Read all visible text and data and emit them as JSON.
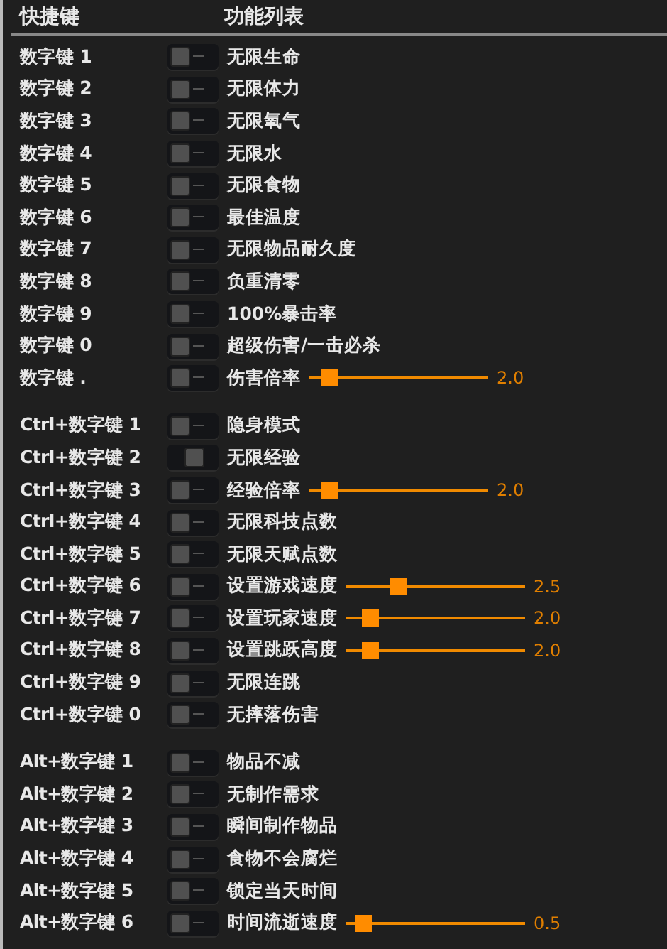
{
  "header": {
    "key_column": "快捷键",
    "function_column": "功能列表"
  },
  "groups": [
    {
      "rows": [
        {
          "key": "数字键 1",
          "label": "无限生命",
          "on": false
        },
        {
          "key": "数字键 2",
          "label": "无限体力",
          "on": false
        },
        {
          "key": "数字键 3",
          "label": "无限氧气",
          "on": false
        },
        {
          "key": "数字键 4",
          "label": "无限水",
          "on": false
        },
        {
          "key": "数字键 5",
          "label": "无限食物",
          "on": false
        },
        {
          "key": "数字键 6",
          "label": "最佳温度",
          "on": false
        },
        {
          "key": "数字键 7",
          "label": "无限物品耐久度",
          "on": false
        },
        {
          "key": "数字键 8",
          "label": "负重清零",
          "on": false
        },
        {
          "key": "数字键 9",
          "label": "100%暴击率",
          "on": false
        },
        {
          "key": "数字键 0",
          "label": "超级伤害/一击必杀",
          "on": false
        },
        {
          "key": "数字键 .",
          "label": "伤害倍率",
          "on": false,
          "slider": {
            "level": 0.07,
            "reading": "2.0"
          }
        }
      ]
    },
    {
      "rows": [
        {
          "key": "Ctrl+数字键 1",
          "label": "隐身模式",
          "on": false
        },
        {
          "key": "Ctrl+数字键 2",
          "label": "无限经验",
          "on": true
        },
        {
          "key": "Ctrl+数字键 3",
          "label": "经验倍率",
          "on": false,
          "slider": {
            "level": 0.07,
            "reading": "2.0"
          }
        },
        {
          "key": "Ctrl+数字键 4",
          "label": "无限科技点数",
          "on": false
        },
        {
          "key": "Ctrl+数字键 5",
          "label": "无限天赋点数",
          "on": false
        },
        {
          "key": "Ctrl+数字键 6",
          "label": "设置游戏速度",
          "on": false,
          "slider": {
            "level": 0.27,
            "reading": "2.5"
          }
        },
        {
          "key": "Ctrl+数字键 7",
          "label": "设置玩家速度",
          "on": false,
          "slider": {
            "level": 0.1,
            "reading": "2.0"
          }
        },
        {
          "key": "Ctrl+数字键 8",
          "label": "设置跳跃高度",
          "on": false,
          "slider": {
            "level": 0.1,
            "reading": "2.0"
          }
        },
        {
          "key": "Ctrl+数字键 9",
          "label": "无限连跳",
          "on": false
        },
        {
          "key": "Ctrl+数字键 0",
          "label": "无摔落伤害",
          "on": false
        }
      ]
    },
    {
      "rows": [
        {
          "key": "Alt+数字键 1",
          "label": "物品不减",
          "on": false
        },
        {
          "key": "Alt+数字键 2",
          "label": "无制作需求",
          "on": false
        },
        {
          "key": "Alt+数字键 3",
          "label": "瞬间制作物品",
          "on": false
        },
        {
          "key": "Alt+数字键 4",
          "label": "食物不会腐烂",
          "on": false
        },
        {
          "key": "Alt+数字键 5",
          "label": "锁定当天时间",
          "on": false
        },
        {
          "key": "Alt+数字键 6",
          "label": "时间流逝速度",
          "on": false,
          "slider": {
            "level": 0.05,
            "reading": "0.5"
          }
        }
      ]
    }
  ]
}
